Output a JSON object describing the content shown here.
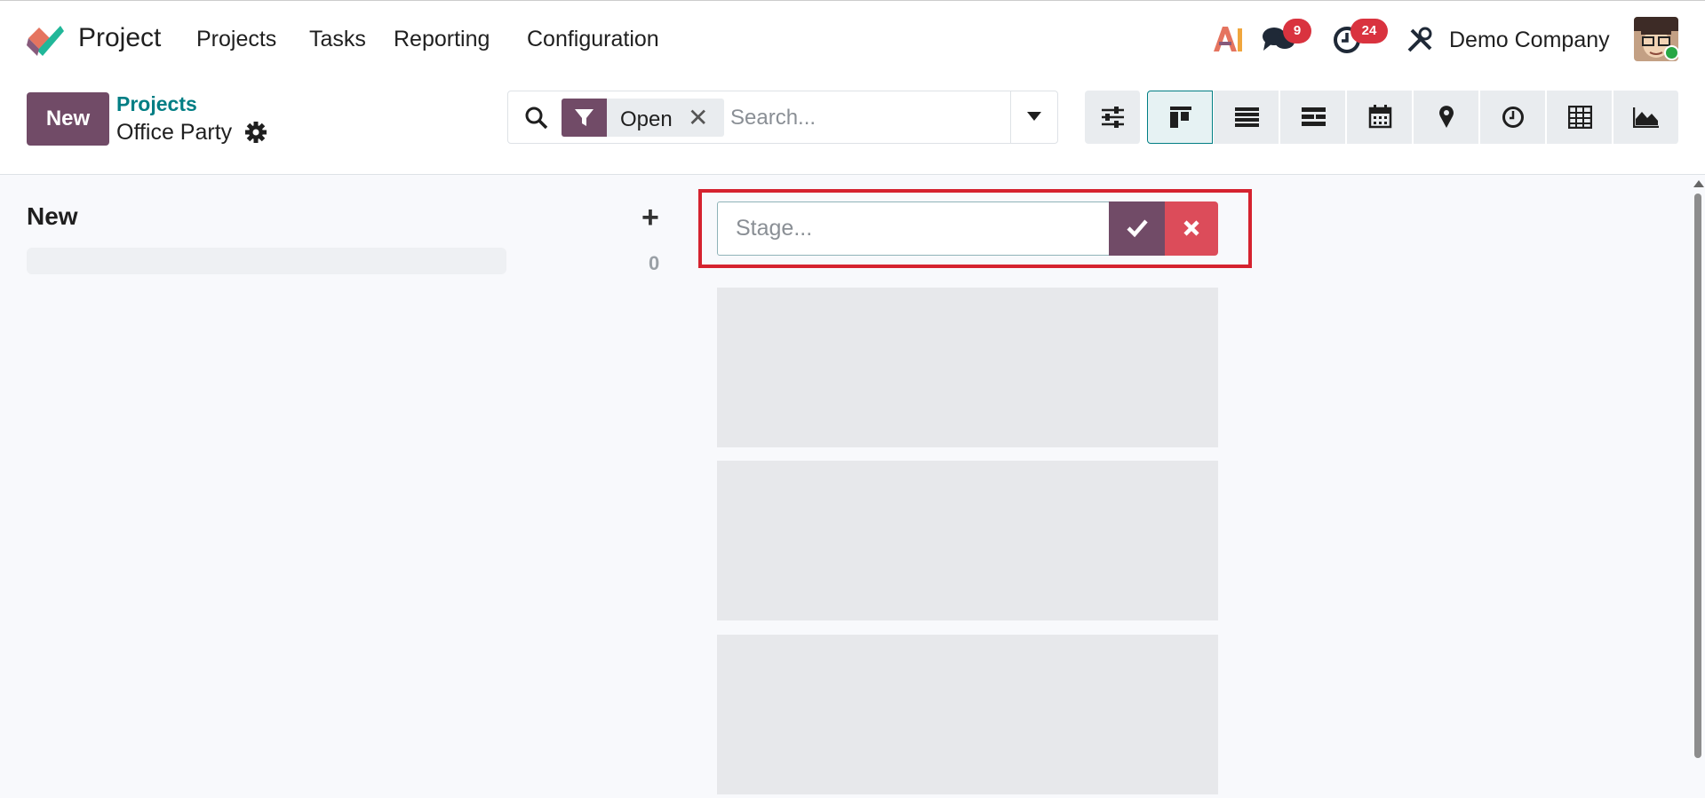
{
  "nav": {
    "app_name": "Project",
    "menu": [
      "Projects",
      "Tasks",
      "Reporting",
      "Configuration"
    ],
    "messages_count": "9",
    "activities_count": "24",
    "company": "Demo Company",
    "icons": {
      "ai": "ai-icon",
      "messages": "chat-icon",
      "activities": "clock-icon",
      "debug": "tools-icon"
    }
  },
  "control": {
    "new_label": "New",
    "breadcrumb_parent": "Projects",
    "breadcrumb_current": "Office Party",
    "facet_label": "Open",
    "facet_close": "✕",
    "search_placeholder": "Search...",
    "views": [
      "kanban",
      "list",
      "gantt",
      "calendar",
      "map",
      "activity",
      "pivot",
      "graph"
    ],
    "active_view": "kanban"
  },
  "kanban": {
    "column_title": "New",
    "column_count": "0",
    "add_symbol": "+",
    "stage_placeholder": "Stage..."
  },
  "colors": {
    "brand": "#714b67",
    "teal": "#017e84",
    "danger": "#d9333f",
    "highlight_frame": "#d5222f"
  }
}
